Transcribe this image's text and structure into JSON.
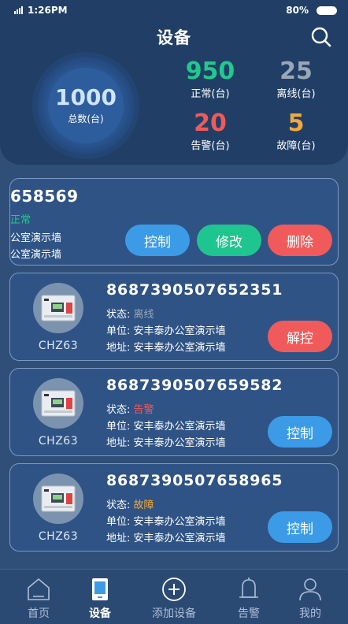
{
  "status_bar": {
    "time": "1:26PM",
    "battery": "80%"
  },
  "header": {
    "title": "设备"
  },
  "summary": {
    "total_value": "1000",
    "total_label": "总数(台)",
    "normal_value": "950",
    "normal_label": "正常(台)",
    "offline_value": "25",
    "offline_label": "离线(台)",
    "alarm_value": "20",
    "alarm_label": "告警(台)",
    "fault_value": "5",
    "fault_label": "故障(台)"
  },
  "colors": {
    "normal": "#21c98c",
    "offline": "#9aa7b6",
    "alarm": "#ef5a5a",
    "fault": "#f2a93b"
  },
  "detail_card": {
    "id": "658569",
    "status": "正常",
    "line1": "公室演示墙",
    "line2": "公室演示墙",
    "control_label": "控制",
    "edit_label": "修改",
    "delete_label": "删除"
  },
  "devices": [
    {
      "model": "CHZ63",
      "id": "8687390507652351",
      "status_key": "状态: ",
      "status": "离线",
      "unit": "单位: 安丰泰办公室演示墙",
      "address": "地址: 安丰泰办公室演示墙",
      "action": "解控"
    },
    {
      "model": "CHZ63",
      "id": "8687390507659582",
      "status_key": "状态: ",
      "status": "告警",
      "unit": "单位: 安丰泰办公室演示墙",
      "address": "地址: 安丰泰办公室演示墙",
      "action": "控制"
    },
    {
      "model": "CHZ63",
      "id": "8687390507658965",
      "status_key": "状态: ",
      "status": "故障",
      "unit": "单位: 安丰泰办公室演示墙",
      "address": "地址: 安丰泰办公室演示墙",
      "action": "控制"
    }
  ],
  "tabbar": {
    "home": "首页",
    "devices": "设备",
    "add": "添加设备",
    "alarm": "告警",
    "mine": "我的"
  }
}
